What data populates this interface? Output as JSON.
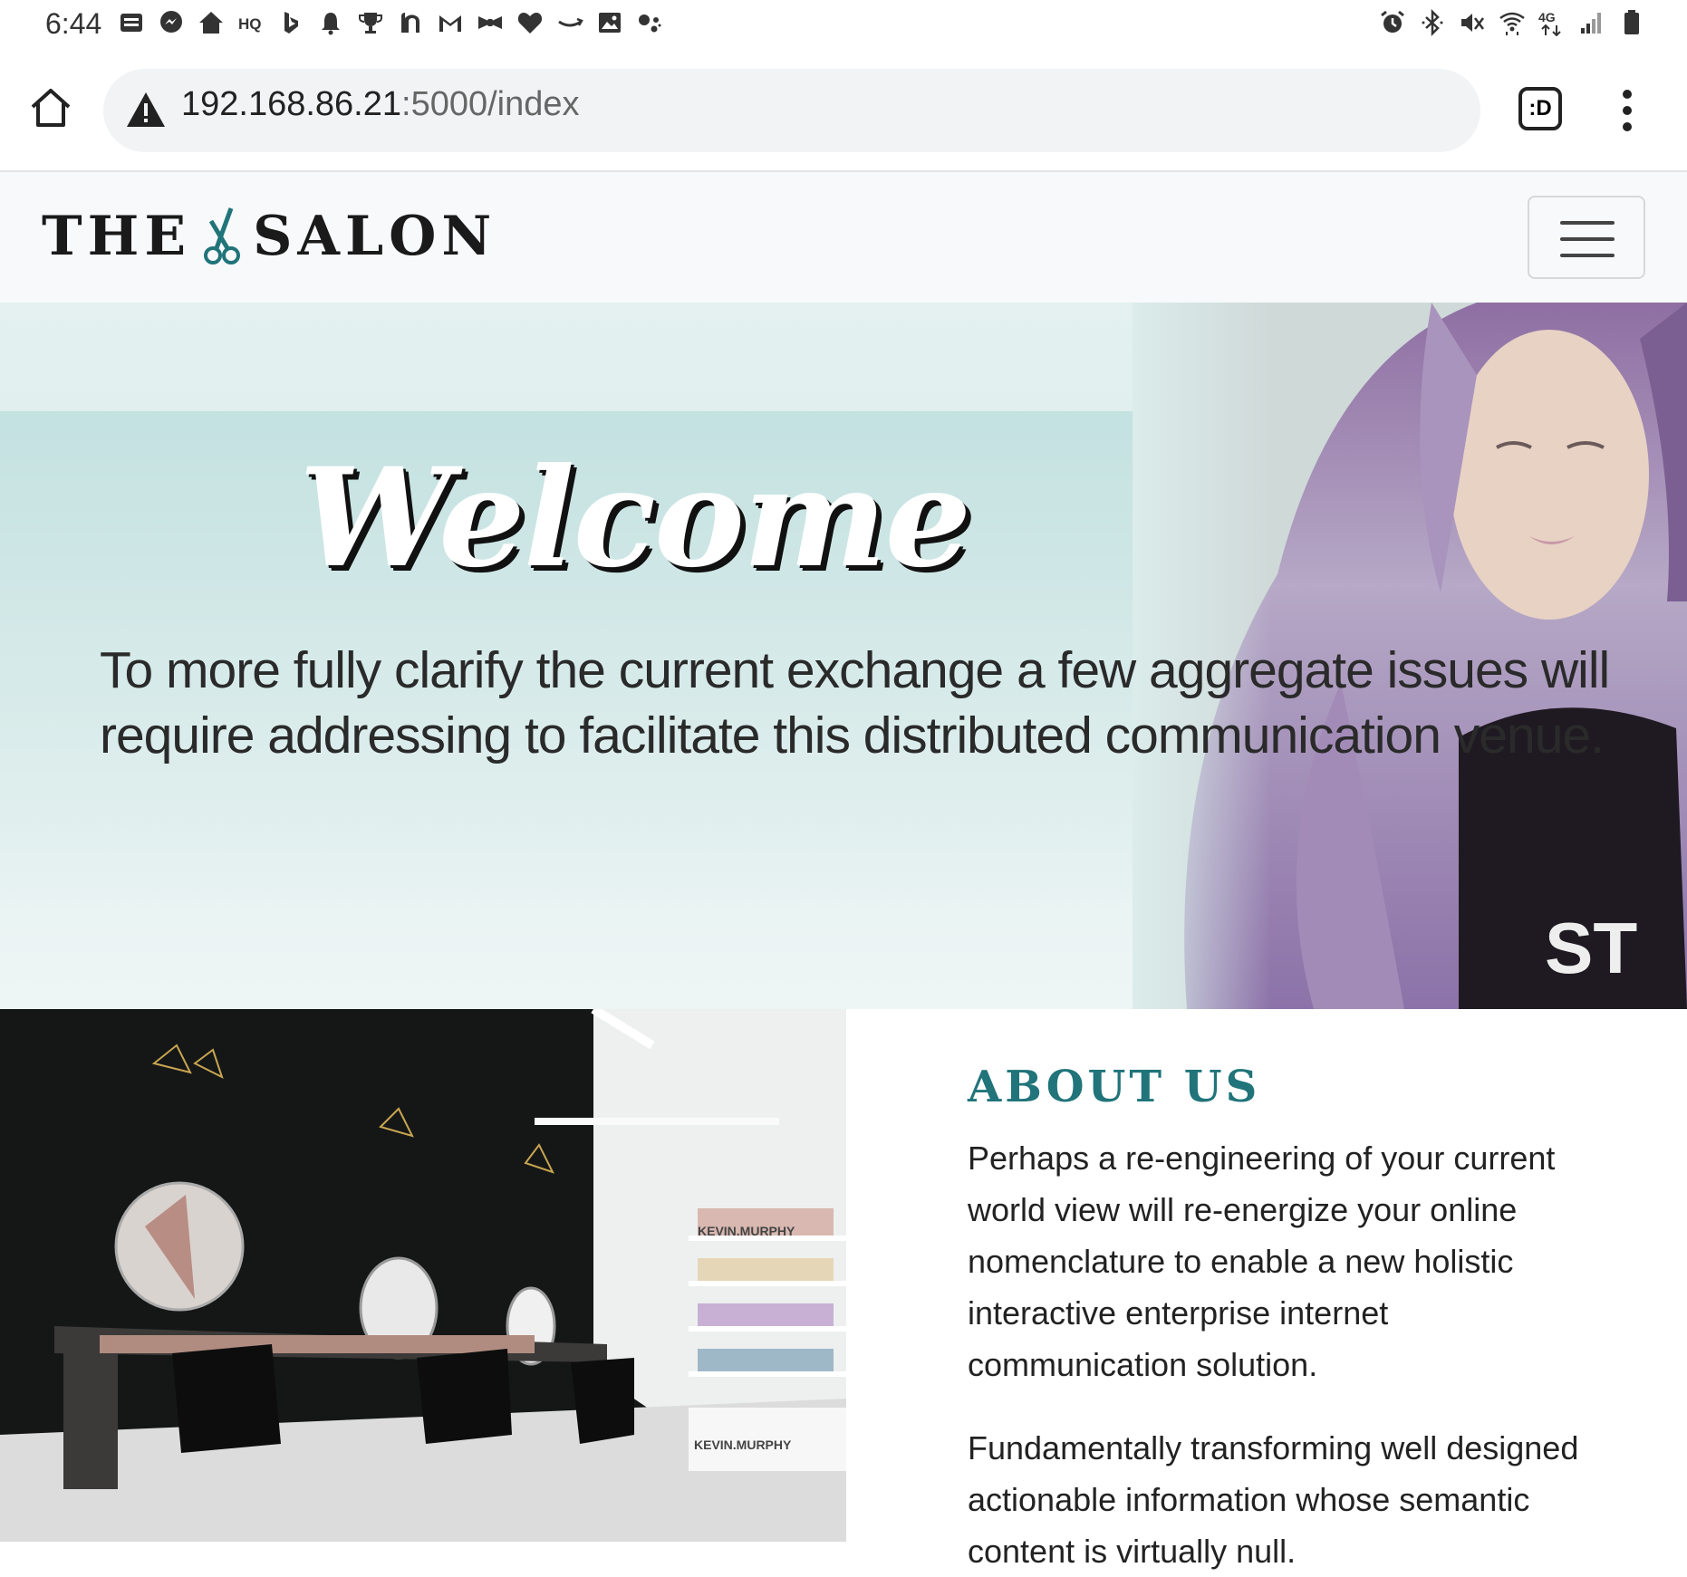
{
  "status_bar": {
    "time": "6:44",
    "left_icons": [
      "news-icon",
      "messenger-icon",
      "home-app-icon",
      "hq-icon",
      "bing-icon",
      "bell-icon",
      "trophy-icon",
      "app-icon",
      "gmail-icon",
      "bow-icon",
      "heart-icon",
      "amazon-icon",
      "gallery-icon",
      "assistant-icon"
    ],
    "right_icons": [
      "alarm-icon",
      "bluetooth-icon",
      "mute-icon",
      "wifi-icon",
      "lte-icon",
      "signal-icon",
      "battery-icon"
    ]
  },
  "browser": {
    "url_host": "192.168.86.21",
    "url_rest": ":5000/index",
    "tabs_label": ":D"
  },
  "navbar": {
    "logo_left": "THE",
    "logo_right": "SALON"
  },
  "hero": {
    "title": "Welcome",
    "text": "To more fully clarify the current exchange a few aggregate issues will require addressing to facilitate this distributed communication venue."
  },
  "about": {
    "heading": "ABOUT US",
    "paragraph1": "Perhaps a re-engineering of your current world view will re-energize your online nomenclature to enable a new holistic interactive enterprise internet communication solution.",
    "paragraph2": "Fundamentally transforming well designed actionable information whose semantic content is virtually null."
  },
  "colors": {
    "accent": "#20747a",
    "hero_bg": "#dbeceb",
    "navbar_bg": "#f8f9fa"
  }
}
